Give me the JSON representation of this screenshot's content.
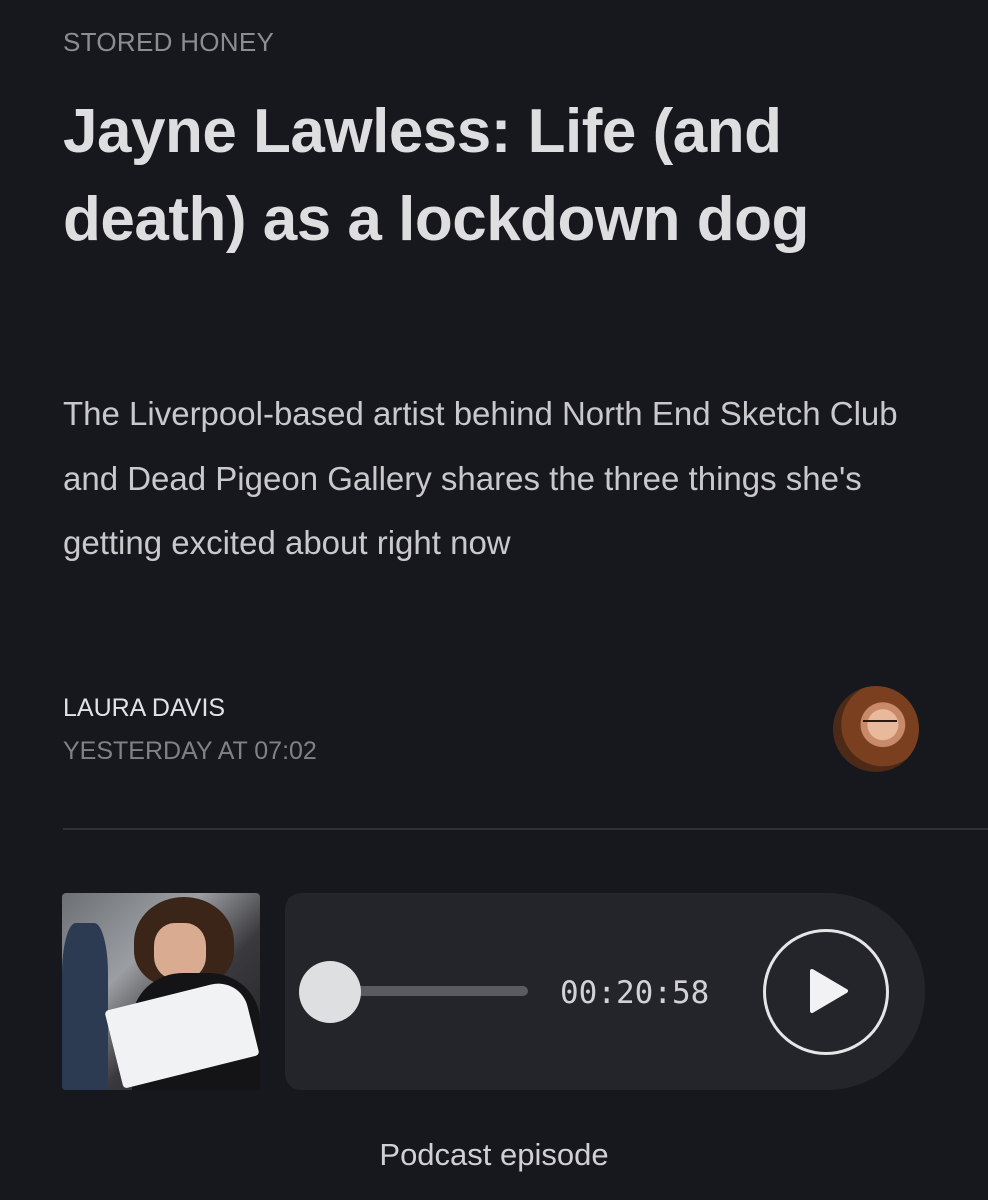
{
  "article": {
    "kicker": "STORED HONEY",
    "headline": "Jayne Lawless: Life (and death) as a lockdown dog",
    "standfirst": "The Liverpool-based artist behind North End Sketch Club and Dead Pigeon Gallery shares the three things she's getting excited about right now"
  },
  "byline": {
    "author": "LAURA DAVIS",
    "timestamp": "YESTERDAY AT 07:02",
    "avatar_icon": "author-avatar"
  },
  "player": {
    "time": "00:20:58",
    "progress": 0,
    "play_icon": "play-icon",
    "caption": "Podcast episode"
  },
  "colors": {
    "background": "#17181d",
    "player_background": "#24252b",
    "text_primary": "#dedee0",
    "text_muted": "#8c8d92"
  }
}
